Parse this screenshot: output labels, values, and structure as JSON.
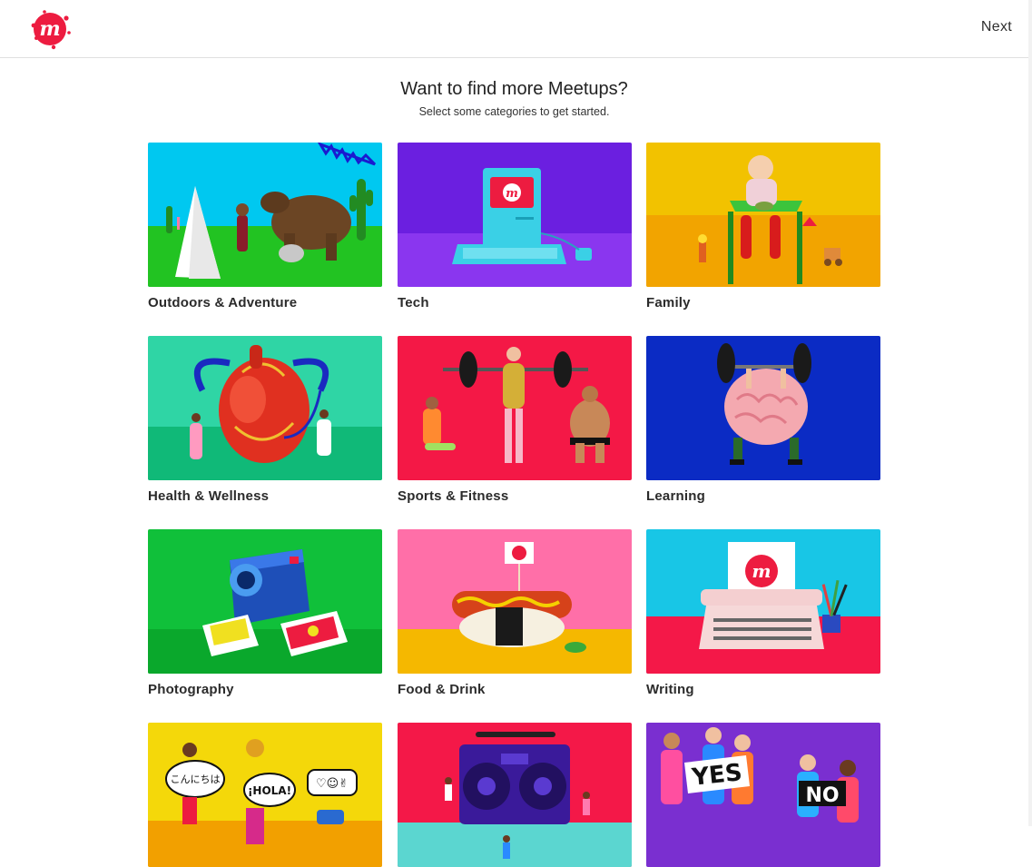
{
  "header": {
    "logo_letter": "m",
    "next_label": "Next"
  },
  "intro": {
    "title": "Want to find more Meetups?",
    "subtitle": "Select some categories to get started."
  },
  "categories": [
    {
      "label": "Outdoors & Adventure",
      "bg": "#00c8f0",
      "ground": "#22c322"
    },
    {
      "label": "Tech",
      "bg": "#6b1fe0",
      "ground": "#8a36ef"
    },
    {
      "label": "Family",
      "bg": "#f2c200",
      "ground": "#f2a400"
    },
    {
      "label": "Health & Wellness",
      "bg": "#2fd5a5",
      "ground": "#10b978"
    },
    {
      "label": "Sports & Fitness",
      "bg": "#f41846",
      "ground": "#e81040"
    },
    {
      "label": "Learning",
      "bg": "#0b2bc4",
      "ground": "#0a24a8"
    },
    {
      "label": "Photography",
      "bg": "#10c03a",
      "ground": "#0aa82c"
    },
    {
      "label": "Food & Drink",
      "bg": "#ff6fa8",
      "ground": "#f5b800"
    },
    {
      "label": "Writing",
      "bg": "#18c6e6",
      "ground": "#f41848"
    },
    {
      "label": "",
      "bg": "#f4d80a",
      "ground": "#f4d80a"
    },
    {
      "label": "",
      "bg": "#f41848",
      "ground": "#5bd6d0"
    },
    {
      "label": "",
      "bg": "#7a2fd0",
      "ground": "#7a2fd0"
    }
  ],
  "image_text": {
    "konnichiwa": "こんにちは",
    "hola": "¡HOLA!",
    "emoji": "♡☺✌",
    "yes": "YES",
    "no": "NO"
  },
  "colors": {
    "brand_red": "#ed1c40",
    "divider": "#e0e0e0"
  }
}
